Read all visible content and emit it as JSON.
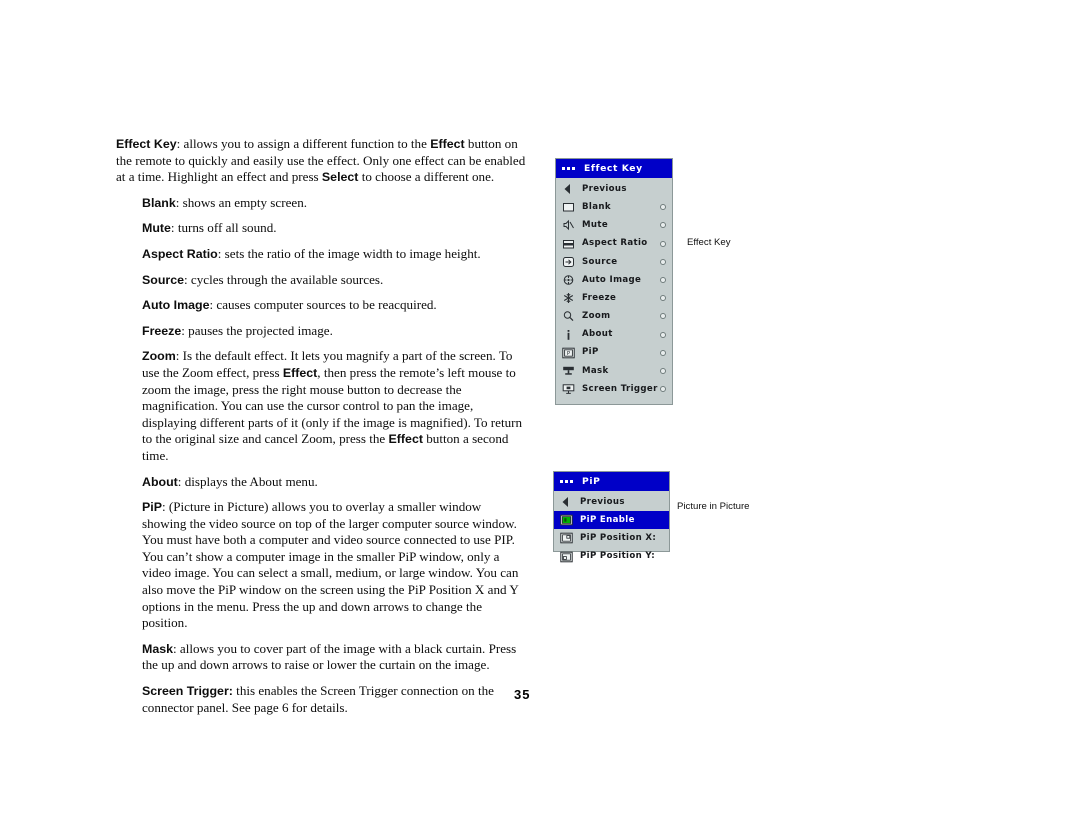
{
  "page": {
    "number": "35"
  },
  "body": {
    "paragraphs": [
      {
        "indent": false,
        "runs": [
          {
            "bold": true,
            "text": "Effect Key"
          },
          {
            "bold": false,
            "text": ": allows you to assign a different function to the "
          },
          {
            "bold": true,
            "text": "Effect"
          },
          {
            "bold": false,
            "text": " button on the remote to quickly and easily use the effect. Only one effect can be enabled at a time. Highlight an effect and press "
          },
          {
            "bold": true,
            "text": "Select"
          },
          {
            "bold": false,
            "text": " to choose a different one."
          }
        ]
      },
      {
        "indent": true,
        "runs": [
          {
            "bold": true,
            "text": "Blank"
          },
          {
            "bold": false,
            "text": ": shows an empty screen."
          }
        ]
      },
      {
        "indent": true,
        "runs": [
          {
            "bold": true,
            "text": "Mute"
          },
          {
            "bold": false,
            "text": ": turns off all sound."
          }
        ]
      },
      {
        "indent": true,
        "runs": [
          {
            "bold": true,
            "text": "Aspect Ratio"
          },
          {
            "bold": false,
            "text": ": sets the ratio of the image width to image height."
          }
        ]
      },
      {
        "indent": true,
        "runs": [
          {
            "bold": true,
            "text": "Source"
          },
          {
            "bold": false,
            "text": ": cycles through the available sources."
          }
        ]
      },
      {
        "indent": true,
        "runs": [
          {
            "bold": true,
            "text": "Auto Image"
          },
          {
            "bold": false,
            "text": ": causes computer sources to be reacquired."
          }
        ]
      },
      {
        "indent": true,
        "runs": [
          {
            "bold": true,
            "text": "Freeze"
          },
          {
            "bold": false,
            "text": ": pauses the projected image."
          }
        ]
      },
      {
        "indent": true,
        "runs": [
          {
            "bold": true,
            "text": "Zoom"
          },
          {
            "bold": false,
            "text": ": Is the default effect. It lets you magnify a part of the screen. To use the Zoom effect, press "
          },
          {
            "bold": true,
            "text": "Effect"
          },
          {
            "bold": false,
            "text": ", then press the remote’s left mouse to zoom the image, press the right mouse button to decrease the magnification. You can use the cursor control to pan the image, displaying different parts of it (only if the image is magnified). To return to the original size and cancel Zoom, press the "
          },
          {
            "bold": true,
            "text": "Effect"
          },
          {
            "bold": false,
            "text": " button a second time."
          }
        ]
      },
      {
        "indent": true,
        "runs": [
          {
            "bold": true,
            "text": "About"
          },
          {
            "bold": false,
            "text": ": displays the About menu."
          }
        ]
      },
      {
        "indent": true,
        "runs": [
          {
            "bold": true,
            "text": "PiP"
          },
          {
            "bold": false,
            "text": ": (Picture in Picture) allows you to overlay a smaller window showing the video source on top of the larger computer source window. You must have both a computer and video source connected to use PIP. You can’t show a computer image in the smaller PiP window, only a video image. You can select a small, medium, or large window. You can also move the PiP window on the screen using the PiP Position X and Y options in the menu. Press the up and down arrows to change the position."
          }
        ]
      },
      {
        "indent": true,
        "runs": [
          {
            "bold": true,
            "text": "Mask"
          },
          {
            "bold": false,
            "text": ": allows you to cover part of the image with a black curtain. Press the up and down arrows to raise or lower the curtain on the image."
          }
        ]
      },
      {
        "indent": true,
        "runs": [
          {
            "bold": true,
            "text": "Screen Trigger:"
          },
          {
            "bold": false,
            "text": " this enables the Screen Trigger connection on the connector panel. See page 6 for details."
          }
        ]
      }
    ]
  },
  "osd_effect_key": {
    "title": "Effect Key",
    "title_bg": "#0000c8",
    "panel_bg": "#c6cfcf",
    "rows": [
      {
        "label": "Previous",
        "icon": "left-triangle-icon",
        "radio": false,
        "selected": false
      },
      {
        "label": "Blank",
        "icon": "blank-screen-icon",
        "radio": true,
        "selected": false
      },
      {
        "label": "Mute",
        "icon": "mute-speaker-icon",
        "radio": true,
        "selected": false
      },
      {
        "label": "Aspect Ratio",
        "icon": "aspect-ratio-icon",
        "radio": true,
        "selected": false
      },
      {
        "label": "Source",
        "icon": "source-arrow-icon",
        "radio": true,
        "selected": false
      },
      {
        "label": "Auto Image",
        "icon": "auto-image-icon",
        "radio": true,
        "selected": false
      },
      {
        "label": "Freeze",
        "icon": "freeze-snowflake-icon",
        "radio": true,
        "selected": false
      },
      {
        "label": "Zoom",
        "icon": "magnifier-icon",
        "radio": true,
        "selected": false
      },
      {
        "label": "About",
        "icon": "info-i-icon",
        "radio": true,
        "selected": false
      },
      {
        "label": "PiP",
        "icon": "pip-window-icon",
        "radio": true,
        "selected": false
      },
      {
        "label": "Mask",
        "icon": "mask-curtain-icon",
        "radio": true,
        "selected": false
      },
      {
        "label": "Screen Trigger",
        "icon": "screen-trigger-icon",
        "radio": true,
        "selected": false
      }
    ]
  },
  "osd_pip": {
    "title": "PiP",
    "title_bg": "#0000c8",
    "highlight_bg": "#0000c8",
    "rows": [
      {
        "label": "Previous",
        "icon": "left-triangle-icon",
        "radio": false,
        "selected": false
      },
      {
        "label": "PiP Enable",
        "icon": "pip-enable-icon",
        "radio": false,
        "selected": true
      },
      {
        "label": "PiP Position X:",
        "icon": "pip-position-x-icon",
        "radio": false,
        "selected": false
      },
      {
        "label": "PiP Position Y:",
        "icon": "pip-position-y-icon",
        "radio": false,
        "selected": false
      }
    ]
  },
  "callouts": {
    "effect_key": "Effect Key",
    "pip": "Picture in Picture"
  }
}
